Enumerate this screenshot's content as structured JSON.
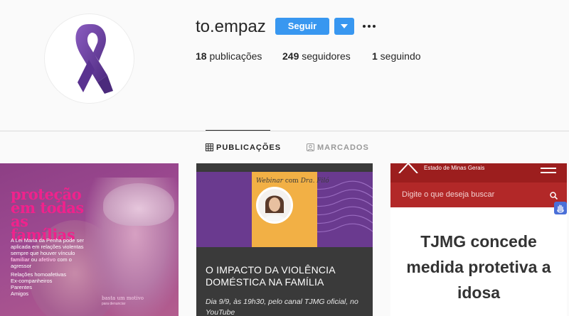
{
  "profile": {
    "username": "to.empaz",
    "follow_label": "Seguir",
    "stats": {
      "posts_count": "18",
      "posts_label": " publicações",
      "followers_count": "249",
      "followers_label": " seguidores",
      "following_count": "1",
      "following_label": " seguindo"
    },
    "avatar_icon": "purple-ribbon-icon"
  },
  "tabs": [
    {
      "label": "PUBLICAÇÕES",
      "icon": "grid-icon",
      "active": true
    },
    {
      "label": "MARCADOS",
      "icon": "tag-person-icon",
      "active": false
    }
  ],
  "posts": [
    {
      "title": "proteção em todas as famílias",
      "body_pre": "A Lei Maria da Penha pode ser aplicada em relações violentas sempre que houver vínculo ",
      "body_b1": "familiar",
      "body_mid": " ou ",
      "body_b2": "afetivo",
      "body_post": " com o agressor",
      "list": [
        "Relações homoafetivas",
        "Ex-companheiros",
        "Parentes",
        "Amigos"
      ],
      "footer": "basta um motivo",
      "footer_small": "para denunciar"
    },
    {
      "webinar": "Webinar",
      "webinar_with": "com",
      "speaker": "Dra. Filó",
      "headline": "O IMPACTO DA VIOLÊNCIA DOMÉSTICA NA FAMÍLIA",
      "subtitle": "Dia 9/9, às 19h30, pelo canal TJMG oficial, no YouTube"
    },
    {
      "org": "Estado de Minas Gerais",
      "search_placeholder": "Digite o que deseja buscar",
      "headline": "TJMG concede medida protetiva a idosa"
    }
  ],
  "colors": {
    "accent": "#3897f0",
    "ribbon": "#6b3fa0",
    "pink": "#f0228c",
    "tjmg_red": "#9c1e1e"
  }
}
